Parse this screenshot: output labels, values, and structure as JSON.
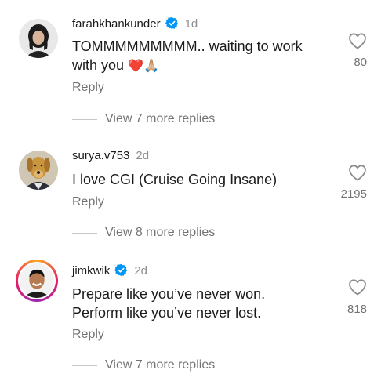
{
  "comments": [
    {
      "username": "farahkhankunder",
      "verified": true,
      "time": "1d",
      "text_line1": "TOMMMMMMMMM.. waiting to work",
      "text_line2": "with you",
      "emoji": "❤️🙏🏼",
      "reply_label": "Reply",
      "likes": "80",
      "view_more": "View 7 more replies"
    },
    {
      "username": "surya.v753",
      "verified": false,
      "time": "2d",
      "text_line1": "I love CGI (Cruise Going Insane)",
      "reply_label": "Reply",
      "likes": "2195",
      "view_more": "View 8 more replies"
    },
    {
      "username": "jimkwik",
      "verified": true,
      "time": "2d",
      "text_line1": "Prepare like you’ve never won.",
      "text_line2": "Perform like you’ve never lost.",
      "reply_label": "Reply",
      "likes": "818",
      "view_more": "View 7 more replies"
    }
  ],
  "colors": {
    "verified": "#0095f6",
    "secondary_text": "#737373",
    "heart_outline": "#8e8e8e"
  },
  "icons": {
    "like": "heart-outline-icon",
    "verified": "verified-badge-icon"
  }
}
